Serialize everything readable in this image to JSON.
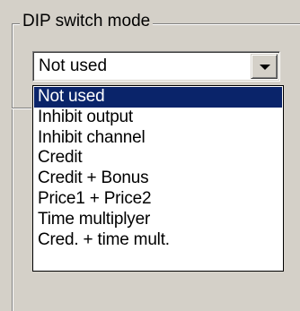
{
  "groupbox": {
    "title": "DIP switch mode"
  },
  "combo": {
    "value": "Not used",
    "button_icon": "chevron-down-icon"
  },
  "dropdown": {
    "selected_index": 0,
    "options": [
      "Not used",
      "Inhibit output",
      "Inhibit channel",
      "Credit",
      "Credit + Bonus",
      "Price1 + Price2",
      "Time multiplyer",
      "Cred. + time mult."
    ]
  },
  "colors": {
    "selection_bg": "#0a246a",
    "selection_text": "#ffffff",
    "face": "#d4d0c8"
  }
}
